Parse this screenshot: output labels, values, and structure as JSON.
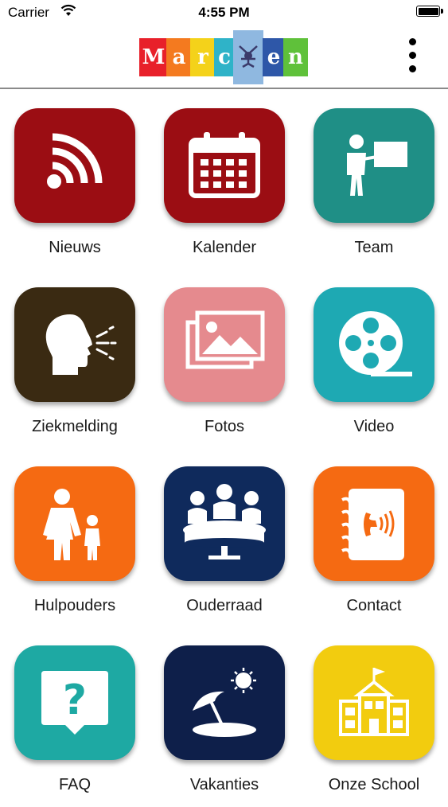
{
  "status_bar": {
    "carrier": "Carrier",
    "time": "4:55 PM"
  },
  "header": {
    "logo_text": "Marc en"
  },
  "tiles": [
    {
      "label": "Nieuws",
      "icon": "rss-icon",
      "color": "#9b0d13"
    },
    {
      "label": "Kalender",
      "icon": "calendar-icon",
      "color": "#9b0d13"
    },
    {
      "label": "Team",
      "icon": "teacher-icon",
      "color": "#1f8f86"
    },
    {
      "label": "Ziekmelding",
      "icon": "speaking-head-icon",
      "color": "#3a2a12"
    },
    {
      "label": "Fotos",
      "icon": "photos-icon",
      "color": "#e58a8e"
    },
    {
      "label": "Video",
      "icon": "film-reel-icon",
      "color": "#1ea9b3"
    },
    {
      "label": "Hulpouders",
      "icon": "parent-child-icon",
      "color": "#f56a12"
    },
    {
      "label": "Ouderraad",
      "icon": "meeting-table-icon",
      "color": "#0f2a5c"
    },
    {
      "label": "Contact",
      "icon": "address-book-phone-icon",
      "color": "#f56a12"
    },
    {
      "label": "FAQ",
      "icon": "question-bubble-icon",
      "color": "#1ea9a3"
    },
    {
      "label": "Vakanties",
      "icon": "beach-umbrella-icon",
      "color": "#0e1f4a"
    },
    {
      "label": "Onze School",
      "icon": "school-building-icon",
      "color": "#f2cc0f"
    }
  ]
}
